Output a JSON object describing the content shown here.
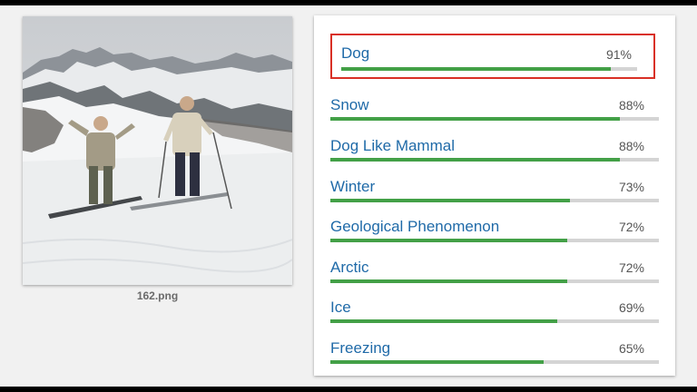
{
  "image": {
    "filename": "162.png"
  },
  "labels": [
    {
      "name": "Dog",
      "score": "91%",
      "fraction": 0.91,
      "highlighted": true
    },
    {
      "name": "Snow",
      "score": "88%",
      "fraction": 0.88
    },
    {
      "name": "Dog Like Mammal",
      "score": "88%",
      "fraction": 0.88
    },
    {
      "name": "Winter",
      "score": "73%",
      "fraction": 0.73
    },
    {
      "name": "Geological Phenomenon",
      "score": "72%",
      "fraction": 0.72
    },
    {
      "name": "Arctic",
      "score": "72%",
      "fraction": 0.72
    },
    {
      "name": "Ice",
      "score": "69%",
      "fraction": 0.69
    },
    {
      "name": "Freezing",
      "score": "65%",
      "fraction": 0.65
    }
  ],
  "colors": {
    "bar": "#43a047",
    "track": "#d4d4d4",
    "highlight_border": "#d93025",
    "label_text": "#1f6aa8"
  }
}
